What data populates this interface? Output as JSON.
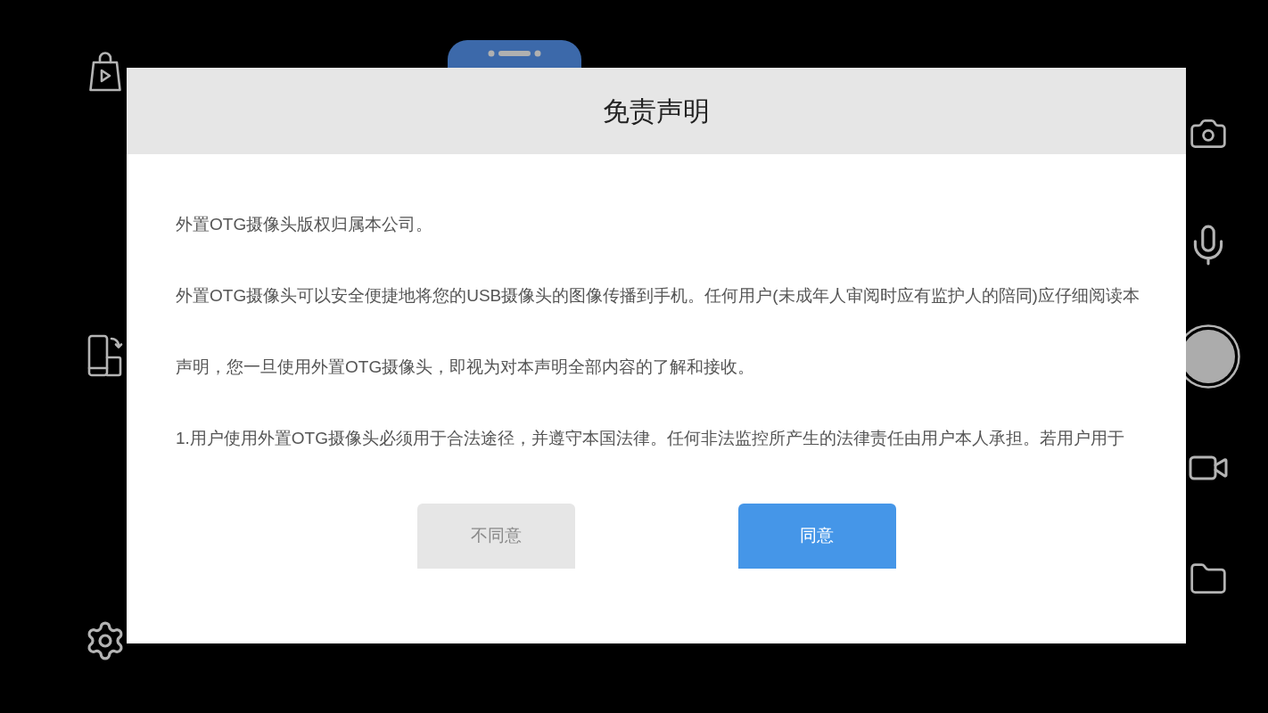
{
  "dialog": {
    "title": "免责声明",
    "paragraphs": [
      "外置OTG摄像头版权归属本公司。",
      "外置OTG摄像头可以安全便捷地将您的USB摄像头的图像传播到手机。任何用户(未成年人审阅时应有监护人的陪同)应仔细阅读本声明，您一旦使用外置OTG摄像头，即视为对本声明全部内容的了解和接收。",
      "1.用户使用外置OTG摄像头必须用于合法途径，并遵守本国法律。任何非法监控所产生的法律责任由用户本人承担。若用户用于"
    ],
    "buttons": [
      {
        "label": "不同意",
        "kind": "secondary"
      },
      {
        "label": "同意",
        "kind": "primary"
      }
    ]
  }
}
